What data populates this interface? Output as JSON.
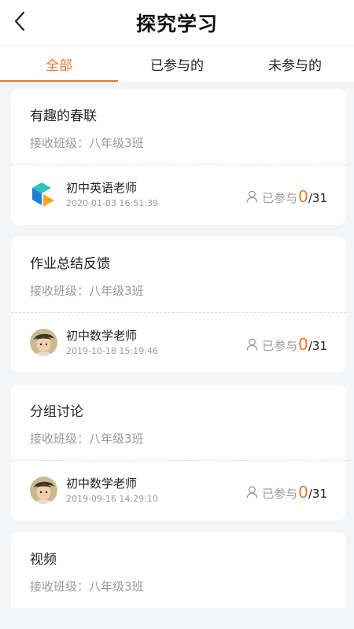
{
  "header": {
    "title": "探究学习",
    "back_icon": "chevron-left-icon"
  },
  "tabs": [
    {
      "label": "全部",
      "active": true
    },
    {
      "label": "已参与的",
      "active": false
    },
    {
      "label": "未参与的",
      "active": false
    }
  ],
  "accent_color": "#e8782e",
  "cards": [
    {
      "title": "有趣的春联",
      "class_label": "接收班级：八年级3班",
      "teacher": "初中英语老师",
      "time": "2020-01-03 16:51:39",
      "avatar": "cube-logo-icon",
      "joined_label": "已参与",
      "joined_count": "0",
      "total": "/31"
    },
    {
      "title": "作业总结反馈",
      "class_label": "接收班级：八年级3班",
      "teacher": "初中数学老师",
      "time": "2019-10-18 15:19:46",
      "avatar": "character-avatar-icon",
      "joined_label": "已参与",
      "joined_count": "0",
      "total": "/31"
    },
    {
      "title": "分组讨论",
      "class_label": "接收班级：八年级3班",
      "teacher": "初中数学老师",
      "time": "2019-09-16 14:29:10",
      "avatar": "character-avatar-icon",
      "joined_label": "已参与",
      "joined_count": "0",
      "total": "/31"
    },
    {
      "title": "视频",
      "class_label": "接收班级：八年级3班"
    }
  ]
}
